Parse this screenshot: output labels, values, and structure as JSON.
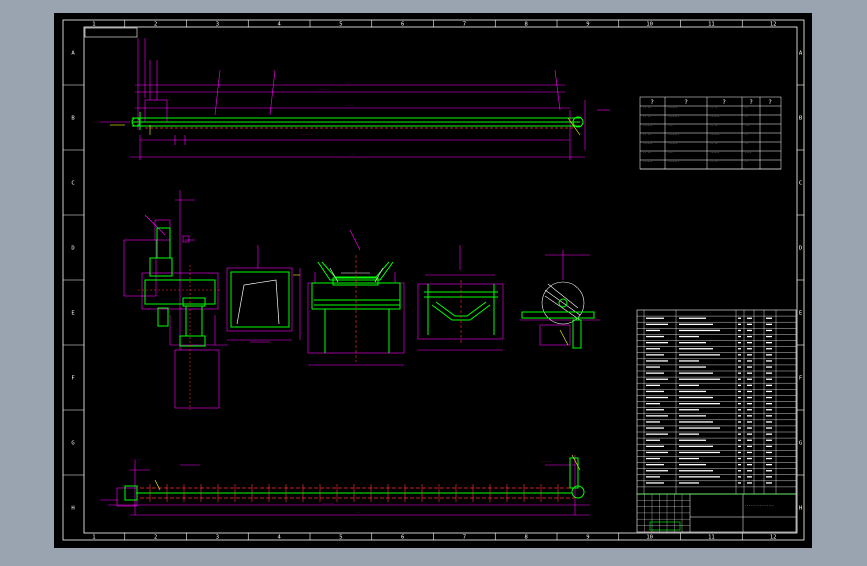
{
  "sheet": {
    "col_labels": [
      "1",
      "2",
      "3",
      "4",
      "5",
      "6",
      "7",
      "8",
      "9",
      "10",
      "11",
      "12"
    ],
    "row_labels": [
      "A",
      "B",
      "C",
      "D",
      "E",
      "F",
      "G",
      "H"
    ]
  },
  "colors": {
    "background": "#9aa3b0",
    "paper": "#000000",
    "frame": "#ffffff",
    "magenta": "#ff00ff",
    "green": "#00ff00",
    "red": "#ff3030",
    "yellow": "#ffff00",
    "cyan": "#00ffff"
  },
  "top_table": {
    "headers": [
      "?",
      "?",
      "?",
      "?",
      "?"
    ]
  },
  "views": [
    "conveyor-elevation-top",
    "drive-unit",
    "head-chute",
    "carrying-idler",
    "return-idler",
    "pulley",
    "conveyor-elevation-bottom"
  ]
}
